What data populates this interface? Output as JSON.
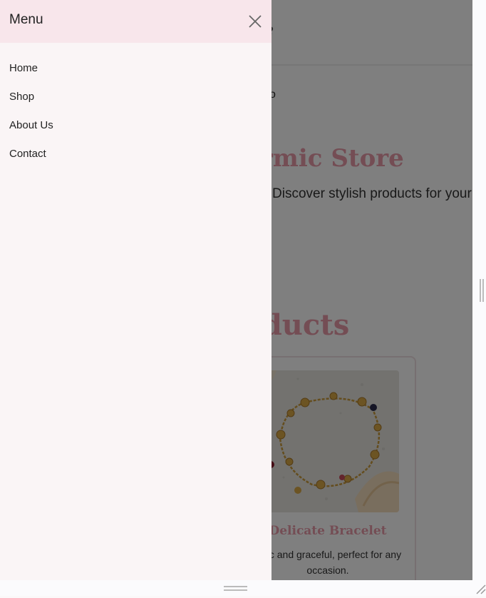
{
  "page": {
    "logo_fragment": "e",
    "nav_fragment": "o",
    "hero_title": "Charmic Store",
    "hero_subtitle": "Discover stylish products for your everyday",
    "section_title": "Products",
    "product": {
      "name": "Delicate Bracelet",
      "description": "Chic and graceful, perfect for any occasion."
    }
  },
  "drawer": {
    "title": "Menu",
    "close_icon": "close-icon",
    "items": [
      {
        "label": "Home"
      },
      {
        "label": "Shop"
      },
      {
        "label": "About Us"
      },
      {
        "label": "Contact"
      }
    ]
  },
  "colors": {
    "accent": "#e89aa9",
    "drawer_header": "#f8e6eb",
    "drawer_body": "#faf5f6"
  }
}
